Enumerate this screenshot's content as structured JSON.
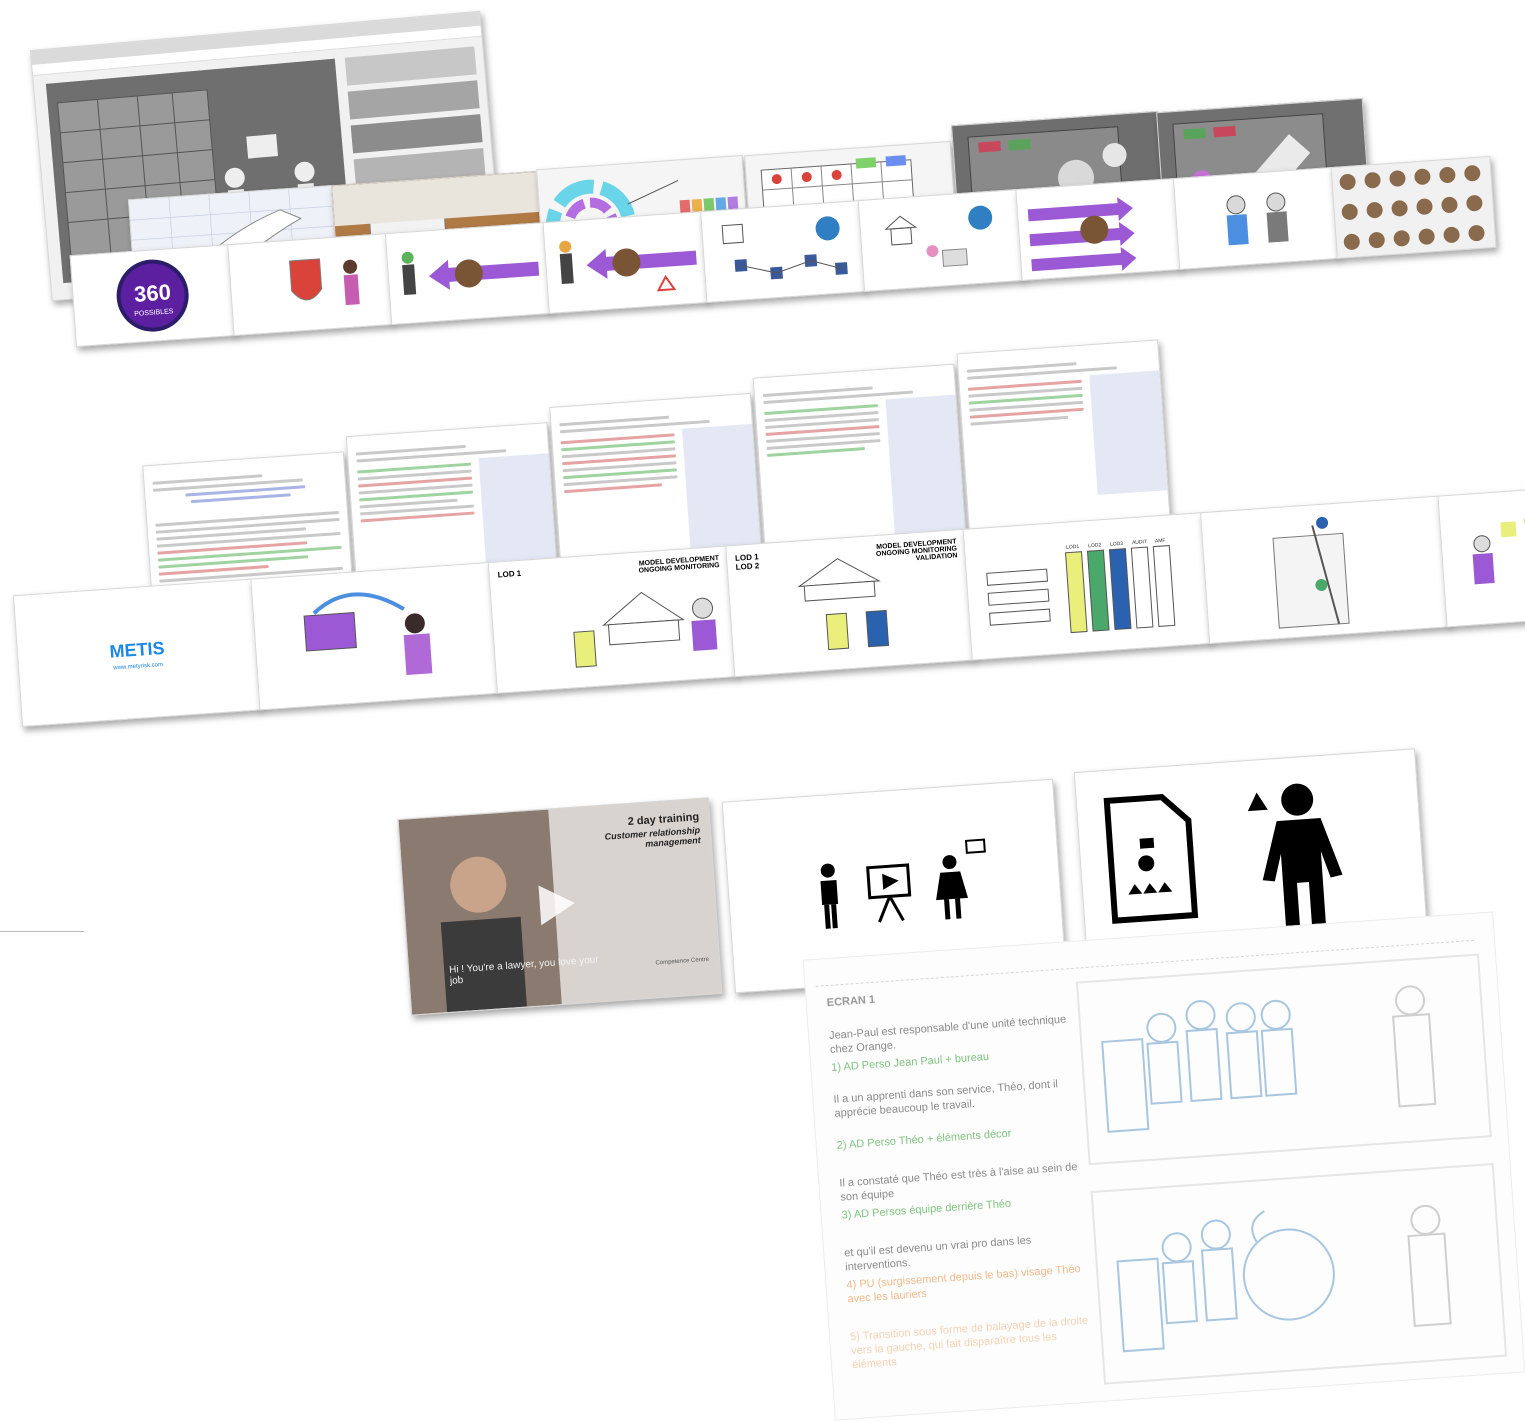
{
  "mosaic": {
    "logo_360": "360",
    "logo_possibles": "POSSIBLES",
    "metis_title": "METIS",
    "metis_url": "www.metyrisk.com",
    "lod_card1_title": "LOD 1",
    "lod_card1_caption": "MODEL DEVELOPMENT ONGOING MONITORING",
    "lod_card2_title": "LOD 1 LOD 2",
    "lod_card2_caption": "MODEL DEVELOPMENT ONGOING MONITORING VALIDATION",
    "lod_boxes": [
      "LOD1",
      "LOD2",
      "LOD3",
      "AUDIT",
      "AMF"
    ],
    "video_title": "2 day training",
    "video_subtitle": "Customer relationship management",
    "video_caption": "Hi ! You're a lawyer, you love your job",
    "video_brand": "Competence Centre",
    "storyboard": {
      "screen_label": "ECRAN 1",
      "lines": [
        {
          "text": "Jean-Paul est responsable d'une unité technique chez Orange.",
          "color": "#8a8a8a"
        },
        {
          "text": "1) AD Perso Jean Paul + bureau",
          "color": "#7fc27f"
        },
        {
          "text": "Il a un apprenti dans son service, Théo, dont il apprécie beaucoup le travail.",
          "color": "#8a8a8a"
        },
        {
          "text": "2) AD Perso Théo + éléments décor",
          "color": "#7fc27f"
        },
        {
          "text": "Il a constaté que Théo est très à l'aise au sein de son équipe",
          "color": "#8a8a8a"
        },
        {
          "text": "3) AD Persos équipe derrière Théo",
          "color": "#7fc27f"
        },
        {
          "text": "et qu'il est devenu un vrai pro dans les interventions.",
          "color": "#8a8a8a"
        },
        {
          "text": "4) PU (surgissement depuis le bas) visage Théo avec les lauriers",
          "color": "#f2b98a"
        },
        {
          "text": "5) Transition sous forme de balayage de la droite vers la gauche, qui fait disparaître tous les éléments",
          "color": "#f2b98a"
        }
      ]
    },
    "colors": {
      "purple": "#9b59d6",
      "lod_yellow": "#e9ef7a",
      "lod_green": "#4aa86a",
      "lod_blue": "#2a62b0",
      "metis_blue": "#1e88e5"
    }
  }
}
